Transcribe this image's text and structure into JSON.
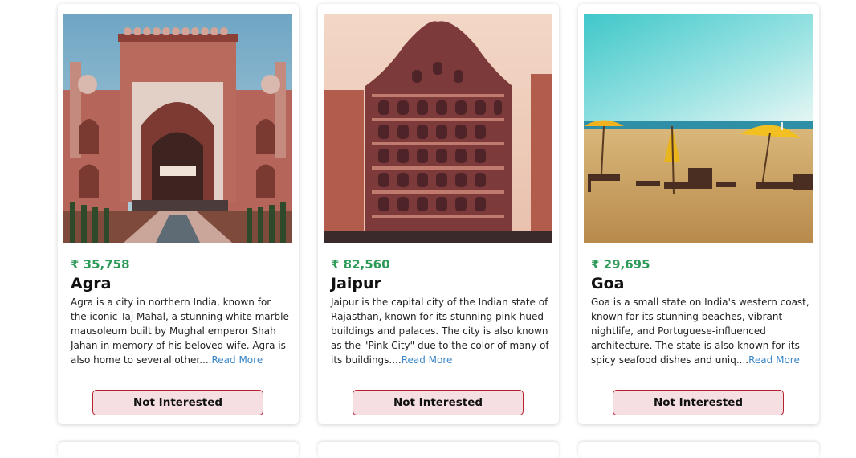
{
  "destinations": [
    {
      "price": "₹ 35,758",
      "name": "Agra",
      "description": "Agra is a city in northern India, known for the iconic Taj Mahal, a stunning white marble mausoleum built by Mughal emperor Shah Jahan in memory of his beloved wife. Agra is also home to several other....",
      "read_more": "Read More",
      "button_label": "Not Interested",
      "image_icon": "agra-monument-photo"
    },
    {
      "price": "₹ 82,560",
      "name": "Jaipur",
      "description": "Jaipur is the capital city of the Indian state of Rajasthan, known for its stunning pink-hued buildings and palaces. The city is also known as the \"Pink City\" due to the color of many of its buildings....",
      "read_more": "Read More",
      "button_label": "Not Interested",
      "image_icon": "jaipur-palace-photo"
    },
    {
      "price": "₹ 29,695",
      "name": "Goa",
      "description": "Goa is a small state on India's western coast, known for its stunning beaches, vibrant nightlife, and Portuguese-influenced architecture. The state is also known for its spicy seafood dishes and uniq....",
      "read_more": "Read More",
      "button_label": "Not Interested",
      "image_icon": "goa-beach-photo"
    }
  ],
  "colors": {
    "price": "#2e9a58",
    "link": "#3a86c8",
    "button_bg": "#f6dfe2",
    "button_border": "#b3232f"
  }
}
